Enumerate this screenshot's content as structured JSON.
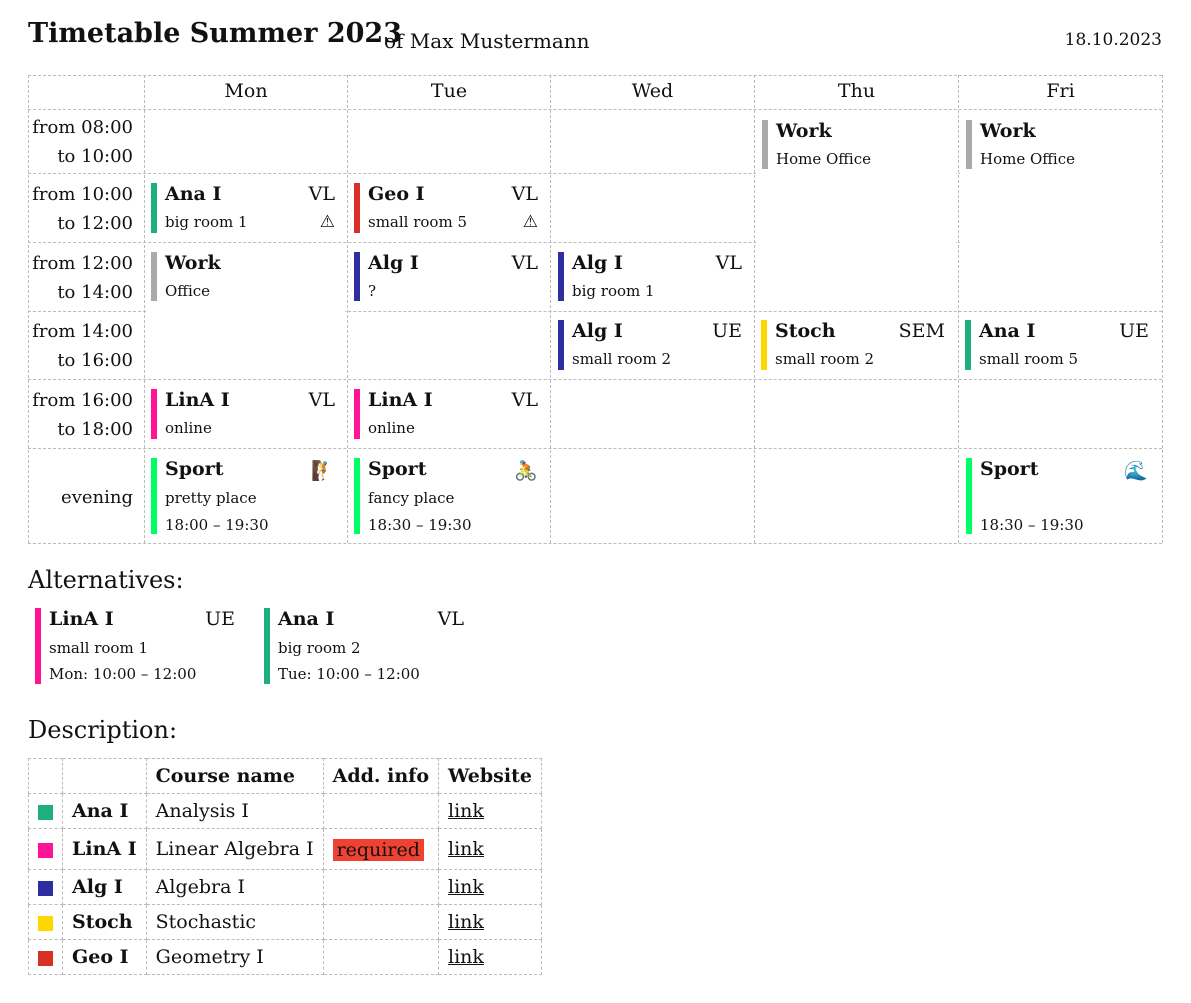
{
  "header": {
    "title": "Timetable Summer 2023",
    "subtitle": "of Max Mustermann",
    "date": "18.10.2023"
  },
  "colors": {
    "Ana I": "#1fae7e",
    "LinA I": "#ff1493",
    "Alg I": "#2e2ea0",
    "Stoch": "#ffd700",
    "Geo I": "#d93025",
    "Work": "#aaaaaa",
    "Sport": "#00ff66"
  },
  "days": [
    "Mon",
    "Tue",
    "Wed",
    "Thu",
    "Fri"
  ],
  "slots": [
    {
      "from": "from 08:00",
      "to": "to 10:00"
    },
    {
      "from": "from 10:00",
      "to": "to 12:00"
    },
    {
      "from": "from 12:00",
      "to": "to 14:00"
    },
    {
      "from": "from 14:00",
      "to": "to 16:00"
    },
    {
      "from": "from 16:00",
      "to": "to 18:00"
    },
    {
      "evening": "evening"
    }
  ],
  "events": {
    "thu_work": {
      "name": "Work",
      "room": "Home Office"
    },
    "fri_work": {
      "name": "Work",
      "room": "Home Office"
    },
    "mon_ana": {
      "name": "Ana I",
      "kind": "VL",
      "room": "big room 1",
      "icon": "⚠"
    },
    "tue_geo": {
      "name": "Geo I",
      "kind": "VL",
      "room": "small room 5",
      "icon": "⚠"
    },
    "mon_work": {
      "name": "Work",
      "room": "Office"
    },
    "tue_alg": {
      "name": "Alg I",
      "kind": "VL",
      "room": "?"
    },
    "wed_alg": {
      "name": "Alg I",
      "kind": "VL",
      "room": "big room 1"
    },
    "wed_alg2": {
      "name": "Alg I",
      "kind": "UE",
      "room": "small room 2"
    },
    "thu_stoch": {
      "name": "Stoch",
      "kind": "SEM",
      "room": "small room 2"
    },
    "fri_ana": {
      "name": "Ana I",
      "kind": "UE",
      "room": "small room 5"
    },
    "mon_lina": {
      "name": "LinA I",
      "kind": "VL",
      "room": "online"
    },
    "tue_lina": {
      "name": "LinA I",
      "kind": "VL",
      "room": "online"
    },
    "mon_sport": {
      "name": "Sport",
      "room": "pretty place",
      "time": "18:00 – 19:30",
      "icon": "🧗"
    },
    "tue_sport": {
      "name": "Sport",
      "room": "fancy place",
      "time": "18:30 – 19:30",
      "icon": "🚴"
    },
    "fri_sport": {
      "name": "Sport",
      "room": "",
      "time": "18:30 – 19:30",
      "icon": "🌊"
    }
  },
  "alternatives": {
    "heading": "Alternatives:",
    "items": [
      {
        "name": "LinA I",
        "kind": "UE",
        "room": "small room 1",
        "time": "Mon: 10:00 – 12:00"
      },
      {
        "name": "Ana I",
        "kind": "VL",
        "room": "big room 2",
        "time": "Tue: 10:00 – 12:00"
      }
    ]
  },
  "description": {
    "heading": "Description:",
    "columns": [
      "",
      "",
      "Course name",
      "Add. info",
      "Website"
    ],
    "rows": [
      {
        "short": "Ana I",
        "name": "Analysis I",
        "info": "",
        "link": "link"
      },
      {
        "short": "LinA I",
        "name": "Linear Algebra I",
        "info": "required",
        "link": "link"
      },
      {
        "short": "Alg I",
        "name": "Algebra I",
        "info": "",
        "link": "link"
      },
      {
        "short": "Stoch",
        "name": "Stochastic",
        "info": "",
        "link": "link"
      },
      {
        "short": "Geo I",
        "name": "Geometry I",
        "info": "",
        "link": "link"
      }
    ]
  }
}
